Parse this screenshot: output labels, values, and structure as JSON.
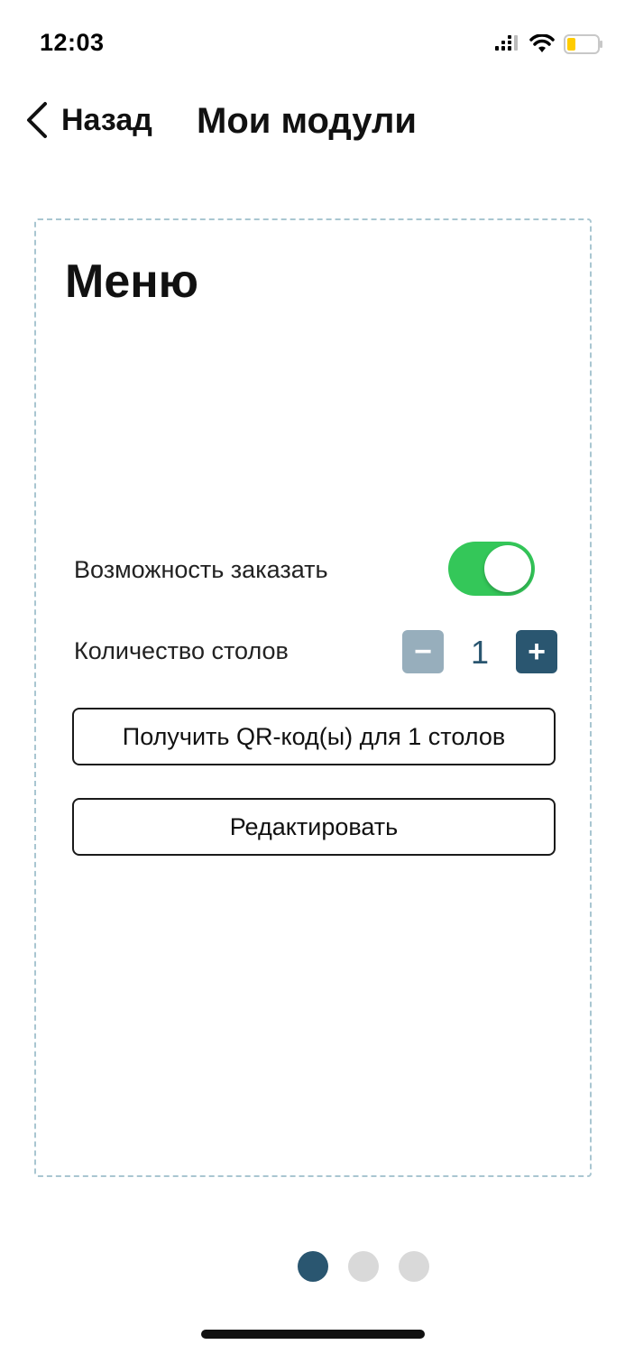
{
  "status_bar": {
    "time": "12:03",
    "icons": [
      "signal-icon",
      "wifi-icon",
      "battery-icon"
    ],
    "battery_color": "#ffcc00"
  },
  "nav": {
    "back_label": "Назад",
    "title": "Мои модули",
    "back_icon": "chevron-left-icon"
  },
  "card": {
    "title": "Меню",
    "order_label": "Возможность заказать",
    "order_enabled": true,
    "tables_label": "Количество столов",
    "tables_count": "1",
    "minus_symbol": "−",
    "plus_symbol": "+",
    "qr_button_label": "Получить QR-код(ы) для 1 столов",
    "edit_button_label": "Редактировать"
  },
  "pagination": {
    "total": 3,
    "active_index": 0
  },
  "colors": {
    "accent": "#2a5670",
    "toggle_on": "#34c759",
    "stepper_disabled": "#97aebc",
    "card_border": "#a9c6d1"
  }
}
